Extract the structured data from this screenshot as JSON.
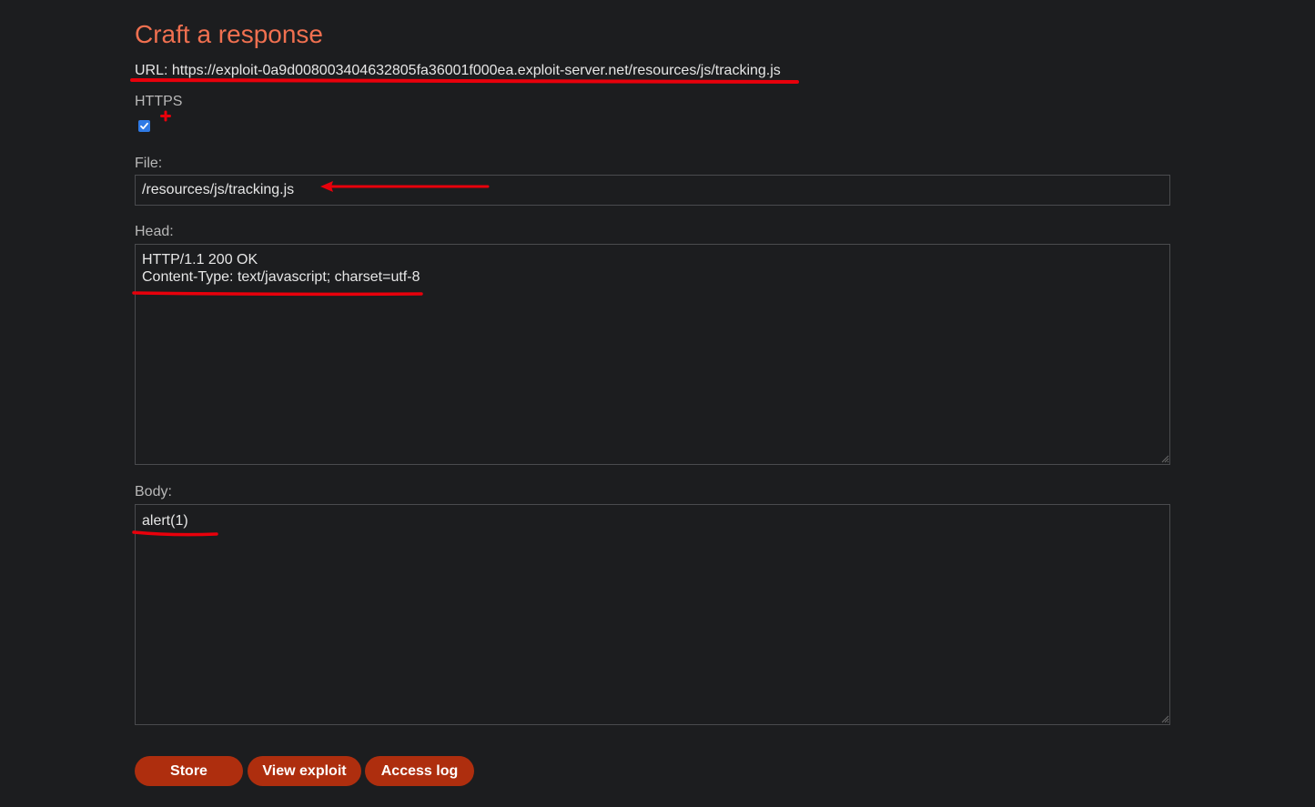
{
  "page": {
    "title": "Craft a response",
    "url_label": "URL:",
    "url_value": "https://exploit-0a9d008003404632805fa36001f000ea.exploit-server.net/resources/js/tracking.js"
  },
  "form": {
    "https_label": "HTTPS",
    "https_checked": true,
    "file_label": "File:",
    "file_value": "/resources/js/tracking.js",
    "head_label": "Head:",
    "head_value": "HTTP/1.1 200 OK\nContent-Type: text/javascript; charset=utf-8",
    "body_label": "Body:",
    "body_value": "alert(1)"
  },
  "buttons": {
    "store": "Store",
    "view_exploit": "View exploit",
    "access_log": "Access log"
  },
  "colors": {
    "background": "#1c1d1f",
    "title": "#f07050",
    "button": "#ae2e0e",
    "annotation": "#e8000b",
    "checkbox": "#2f7ae5"
  },
  "annotations": {
    "description_icons": [
      "red-underline-url",
      "red-plus-mark",
      "red-arrow-file",
      "red-underline-head",
      "red-underline-body"
    ]
  }
}
